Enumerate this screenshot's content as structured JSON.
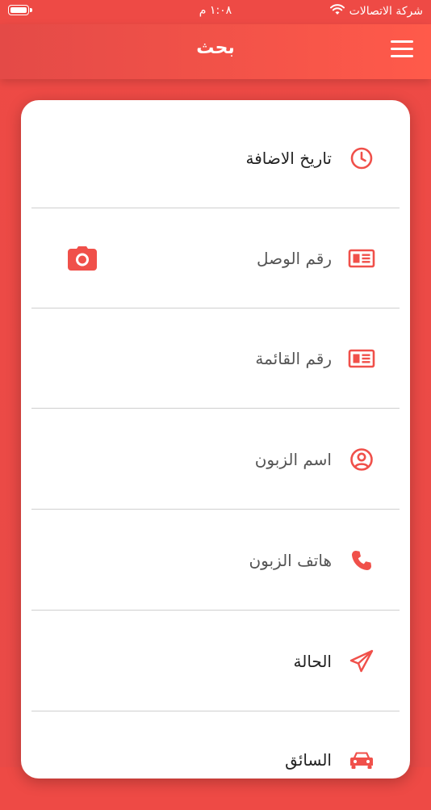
{
  "status_bar": {
    "carrier": "شركة الاتصالات",
    "time": "١:٠٨ م"
  },
  "header": {
    "title": "بحث",
    "menu_icon": "hamburger-menu-icon"
  },
  "search_fields": [
    {
      "label": "تاريخ الاضافة",
      "icon": "clock-icon"
    },
    {
      "label": "رقم الوصل",
      "icon": "newspaper-icon",
      "action_icon": "camera-icon"
    },
    {
      "label": "رقم القائمة",
      "icon": "newspaper-icon"
    },
    {
      "label": "اسم الزبون",
      "icon": "user-circle-icon"
    },
    {
      "label": "هاتف الزبون",
      "icon": "phone-icon"
    },
    {
      "label": "الحالة",
      "icon": "paper-plane-icon"
    },
    {
      "label": "السائق",
      "icon": "car-icon"
    }
  ],
  "colors": {
    "accent": "#f0504a",
    "header_start": "#e44a47",
    "header_end": "#ff5a4a"
  }
}
